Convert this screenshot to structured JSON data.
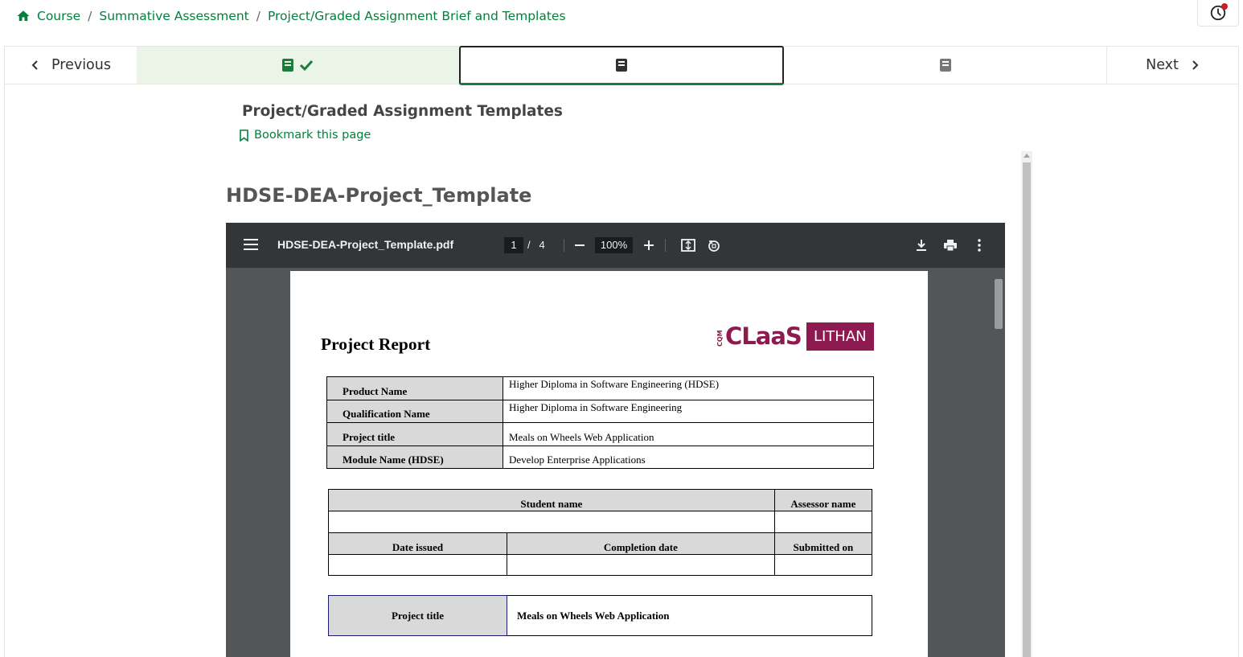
{
  "breadcrumb": {
    "items": [
      "Course",
      "Summative Assessment",
      "Project/Graded Assignment Brief and Templates"
    ],
    "separator": "/"
  },
  "sequence_nav": {
    "previous_label": "Previous",
    "next_label": "Next",
    "units": [
      {
        "status": "completed",
        "icon": "book-icon"
      },
      {
        "status": "active",
        "icon": "book-icon"
      },
      {
        "status": "pending",
        "icon": "book-icon"
      }
    ]
  },
  "unit": {
    "title": "Project/Graded Assignment Templates",
    "bookmark_label": "Bookmark this page"
  },
  "pdf": {
    "heading": "HDSE-DEA-Project_Template",
    "filename": "HDSE-DEA-Project_Template.pdf",
    "current_page": "1",
    "page_separator": "/",
    "total_pages": "4",
    "zoom": "100%"
  },
  "document": {
    "title": "Project Report",
    "logo": {
      "brand": "CLaaS",
      "prefix": "CQM",
      "tag": "LITHAN"
    },
    "info_table": [
      {
        "label": "Product Name",
        "value": "Higher Diploma in Software Engineering (HDSE)"
      },
      {
        "label": "Qualification Name",
        "value": "Higher Diploma in Software Engineering"
      },
      {
        "label": "Project title",
        "value": "Meals on Wheels Web Application"
      },
      {
        "label": "Module Name (HDSE)",
        "value": "Develop Enterprise Applications"
      }
    ],
    "people_table": {
      "student_header": "Student name",
      "assessor_header": "Assessor name",
      "date_issued_header": "Date issued",
      "completion_header": "Completion date",
      "submitted_header": "Submitted on"
    },
    "project_table": {
      "label": "Project title",
      "value": "Meals on Wheels Web Application"
    }
  },
  "colors": {
    "link_green": "#00813c",
    "completed_tab_bg": "#ebf5e7",
    "viewer_toolbar": "#323639",
    "viewer_bg": "#525659",
    "brand_maroon": "#8e1b4f"
  }
}
